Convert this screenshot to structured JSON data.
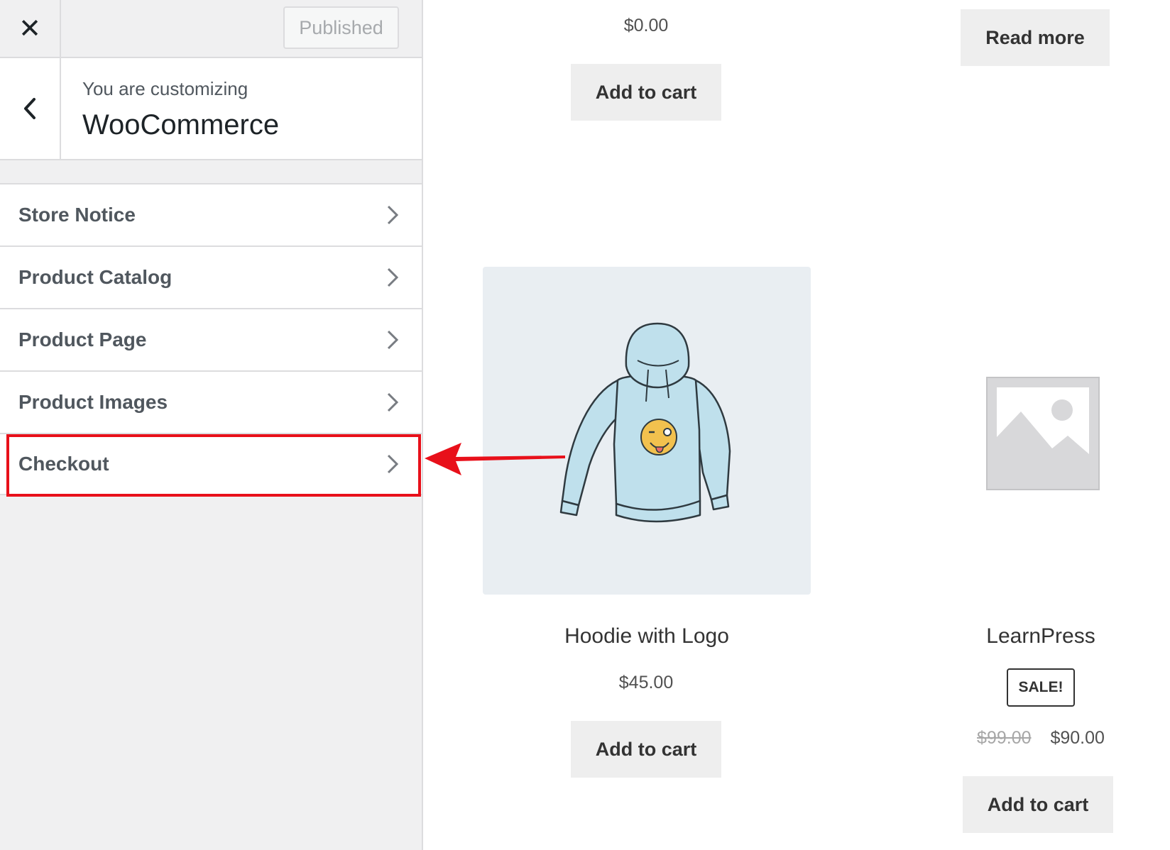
{
  "topbar": {
    "close_label": "✕",
    "publish_label": "Published"
  },
  "info": {
    "subtitle": "You are customizing",
    "title": "WooCommerce"
  },
  "menu": {
    "items": [
      {
        "label": "Store Notice"
      },
      {
        "label": "Product Catalog"
      },
      {
        "label": "Product Page"
      },
      {
        "label": "Product Images"
      },
      {
        "label": "Checkout"
      }
    ]
  },
  "preview": {
    "top_price": "$0.00",
    "top_add_to_cart": "Add to cart",
    "read_more": "Read more",
    "hoodie": {
      "title": "Hoodie with Logo",
      "price": "$45.00",
      "button": "Add to cart"
    },
    "learnpress": {
      "title": "LearnPress",
      "badge": "SALE!",
      "old_price": "$99.00",
      "new_price": "$90.00",
      "button": "Add to cart"
    }
  },
  "colors": {
    "highlight": "#e8101a",
    "sidebar_bg": "#f0f0f1",
    "button_bg": "#eeeeee"
  },
  "icons": [
    "close-icon",
    "back-chevron-icon",
    "chevron-right-icon",
    "hoodie-image",
    "placeholder-image-icon",
    "annotation-arrow"
  ]
}
